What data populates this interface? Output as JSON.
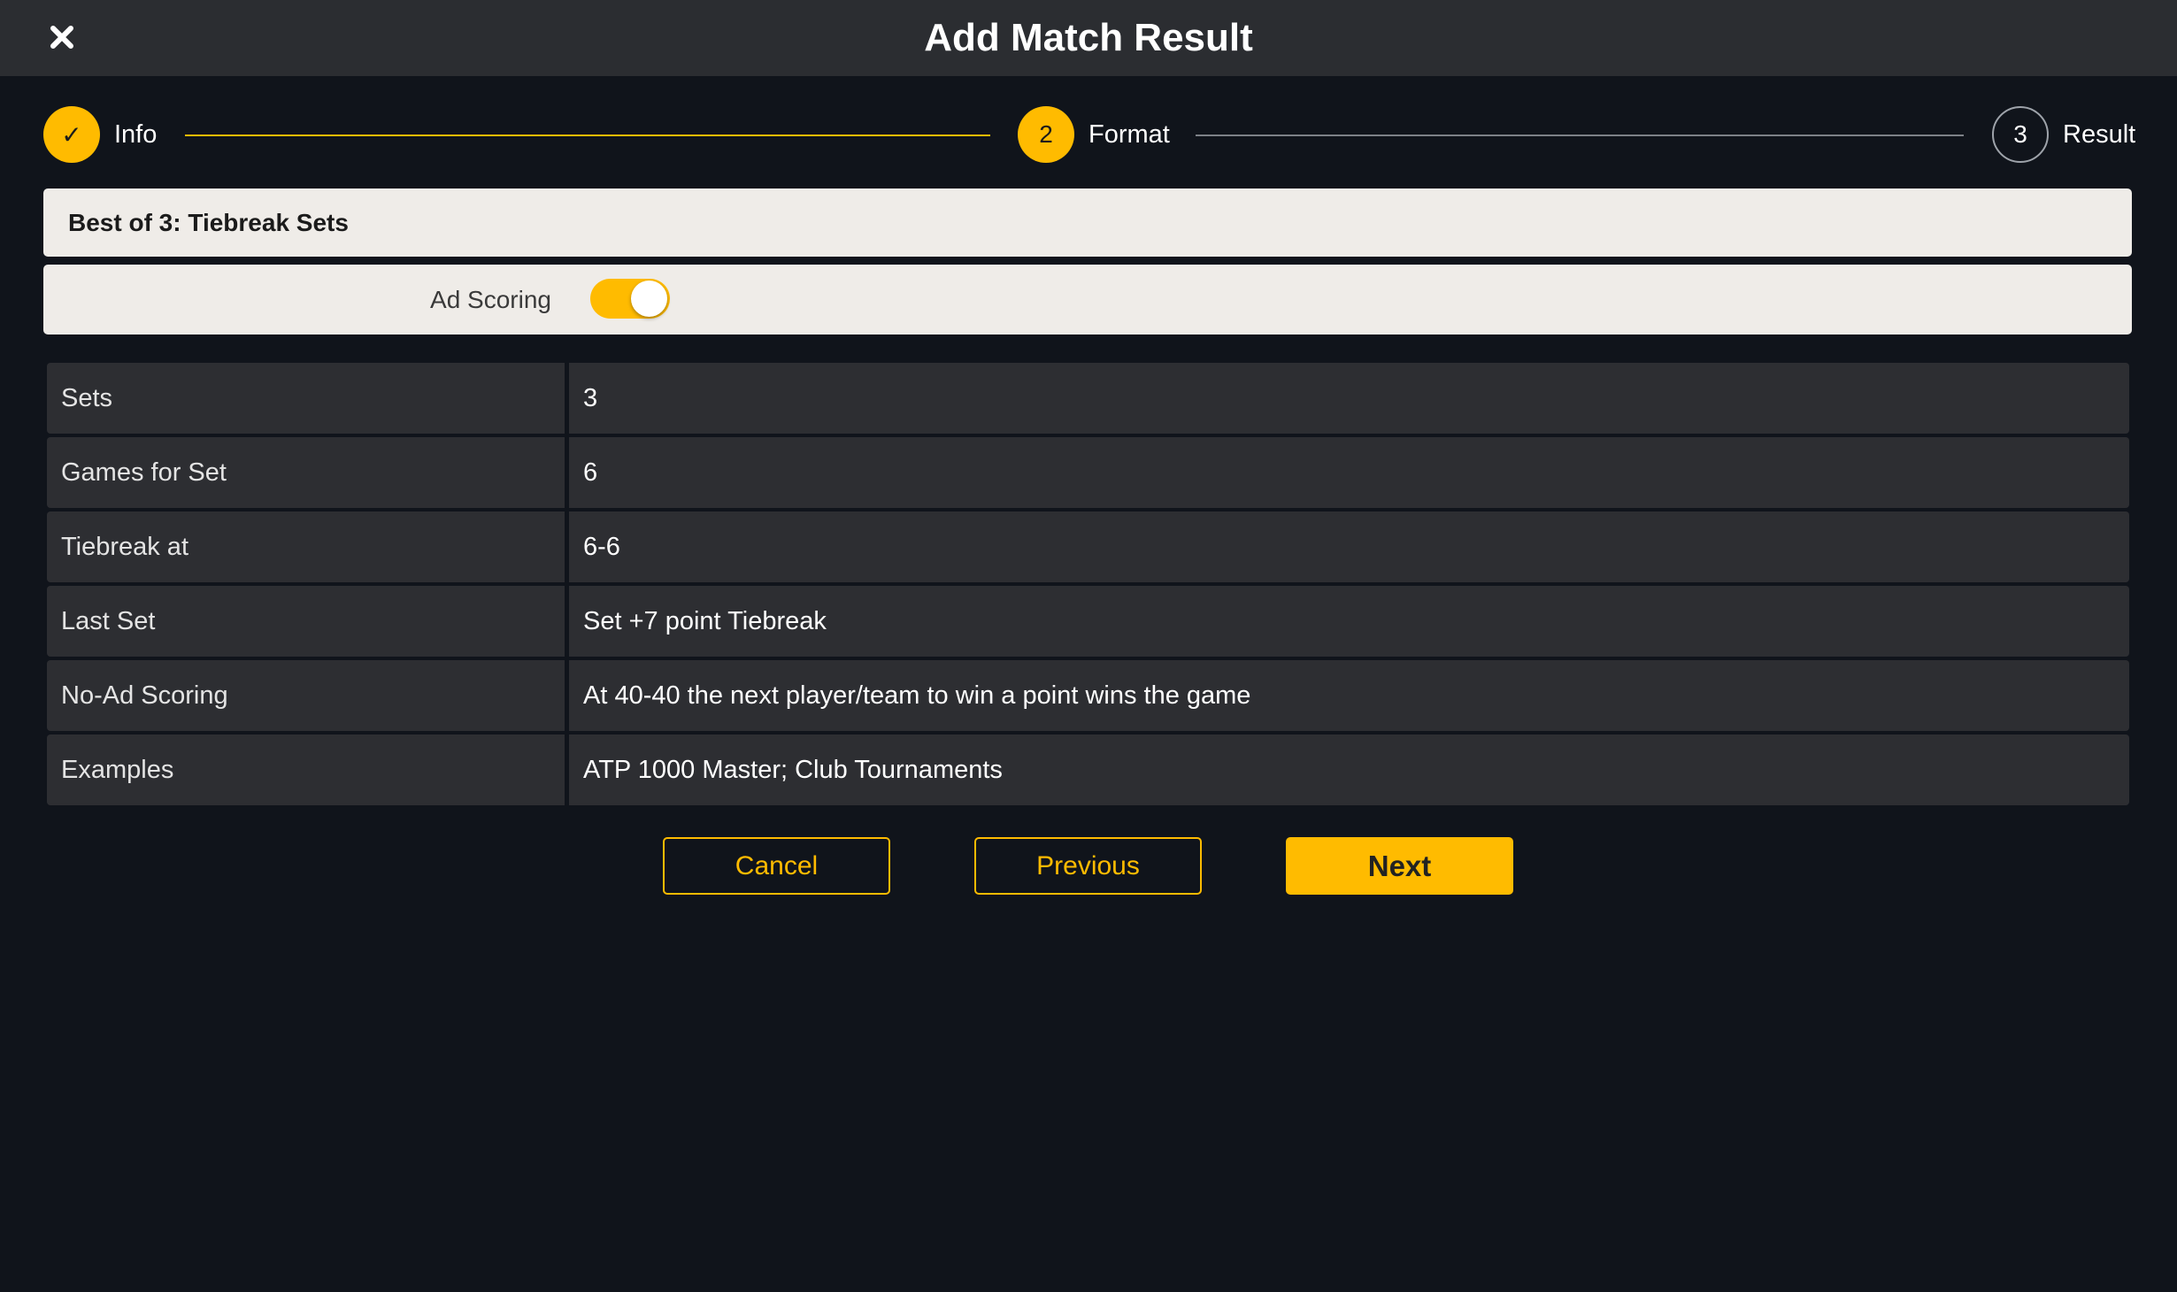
{
  "header": {
    "title": "Add Match Result",
    "close_icon": "close-icon"
  },
  "stepper": {
    "steps": [
      {
        "label": "Info",
        "marker": "✓",
        "state": "done"
      },
      {
        "label": "Format",
        "marker": "2",
        "state": "active"
      },
      {
        "label": "Result",
        "marker": "3",
        "state": "pending"
      }
    ]
  },
  "format": {
    "title": "Best of 3: Tiebreak Sets",
    "ad_scoring_label": "Ad Scoring",
    "ad_scoring_on": true
  },
  "details": [
    {
      "key": "Sets",
      "value": "3"
    },
    {
      "key": "Games for Set",
      "value": "6"
    },
    {
      "key": "Tiebreak at",
      "value": "6-6"
    },
    {
      "key": "Last Set",
      "value": "Set +7 point Tiebreak"
    },
    {
      "key": "No-Ad Scoring",
      "value": "At 40-40 the next player/team to win a point wins the game"
    },
    {
      "key": "Examples",
      "value": "ATP 1000 Master; Club Tournaments"
    }
  ],
  "actions": {
    "cancel": "Cancel",
    "previous": "Previous",
    "next": "Next"
  },
  "colors": {
    "accent": "#ffbb00",
    "background": "#10141b",
    "header": "#2b2d31",
    "panel": "#efece8",
    "row": "#2d2e32"
  }
}
